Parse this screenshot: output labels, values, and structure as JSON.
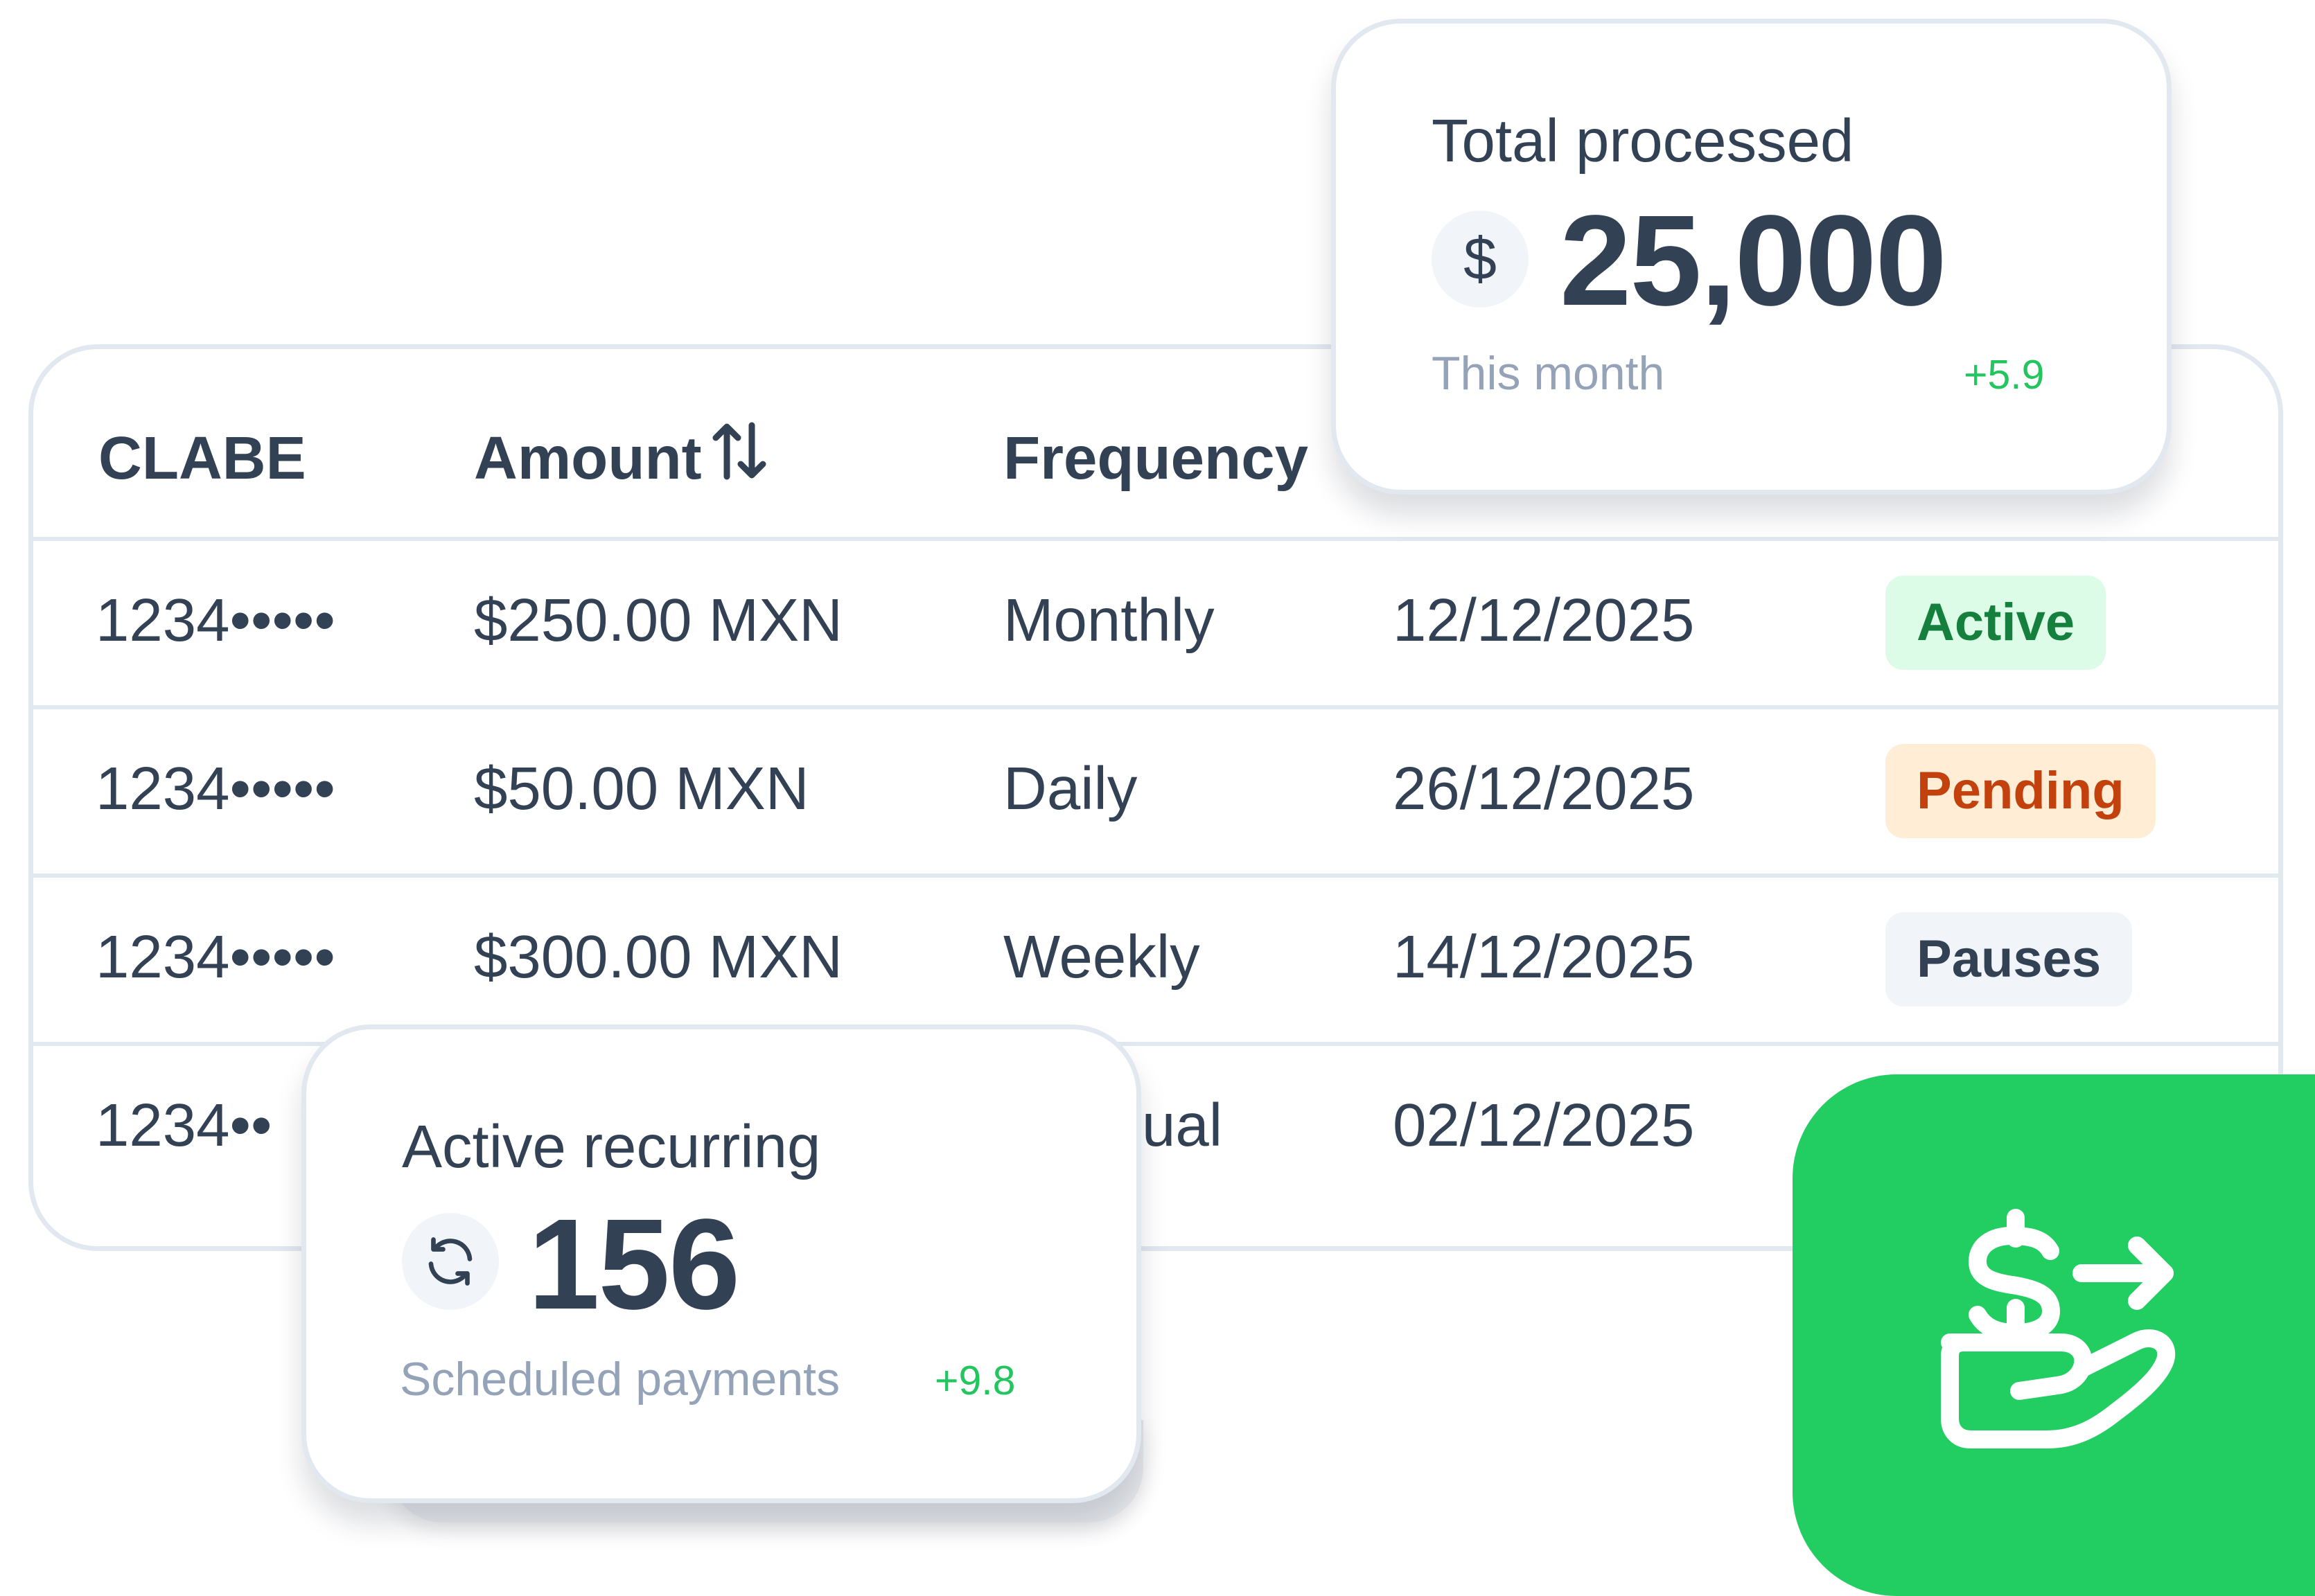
{
  "table": {
    "headers": {
      "clabe": "CLABE",
      "amount": "Amount",
      "frequency": "Frequency"
    },
    "rows": [
      {
        "clabe": "1234•••••",
        "amount": "$250.00 MXN",
        "frequency": "Monthly",
        "date": "12/12/2025",
        "status": "Active"
      },
      {
        "clabe": "1234•••••",
        "amount": "$50.00 MXN",
        "frequency": "Daily",
        "date": "26/12/2025",
        "status": "Pending"
      },
      {
        "clabe": "1234•••••",
        "amount": "$300.00 MXN",
        "frequency": "Weekly",
        "date": "14/12/2025",
        "status": "Pauses"
      },
      {
        "clabe": "1234••",
        "amount": "",
        "frequency": "ual",
        "date": "02/12/2025",
        "status": ""
      }
    ]
  },
  "status_colors": {
    "active": {
      "bg": "#dcfce7",
      "fg": "#15803d"
    },
    "pending": {
      "bg": "#ffedd5",
      "fg": "#c2410c"
    },
    "pauses": {
      "bg": "#f1f5f9",
      "fg": "#334155"
    }
  },
  "total_card": {
    "label": "Total processed",
    "icon": "dollar-icon",
    "icon_glyph": "$",
    "value": "25,000",
    "sub": "This month",
    "delta": "+5.9"
  },
  "recurring_card": {
    "label": "Active recurring",
    "icon": "refresh-icon",
    "value": "156",
    "sub": "Scheduled payments",
    "delta": "+9.8"
  },
  "app_icon": {
    "icon": "hand-dollar-transfer-icon",
    "color": "#22cd62"
  }
}
